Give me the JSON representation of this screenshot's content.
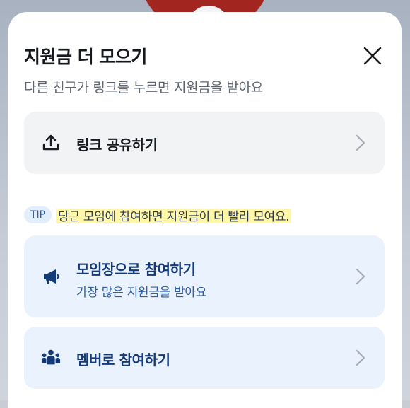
{
  "sheet": {
    "title": "지원금 더 모으기",
    "subtitle": "다른 친구가 링크를 누르면 지원금을 받아요",
    "close_icon": "close-icon"
  },
  "share": {
    "icon": "upload-share-icon",
    "label": "링크 공유하기"
  },
  "tip": {
    "badge": "TIP",
    "text": "당근 모임에 참여하면 지원금이 더 빨리 모여요."
  },
  "join_leader": {
    "icon": "megaphone-icon",
    "label": "모임장으로 참여하기",
    "description": "가장 많은 지원금을 받아요"
  },
  "join_member": {
    "icon": "group-people-icon",
    "label": "멤버로 참여하기"
  },
  "colors": {
    "accent_blue": "#143a78",
    "card_blue_bg": "#eaf2fd",
    "card_gray_bg": "#f2f3f5",
    "highlight": "#fff7a8"
  }
}
